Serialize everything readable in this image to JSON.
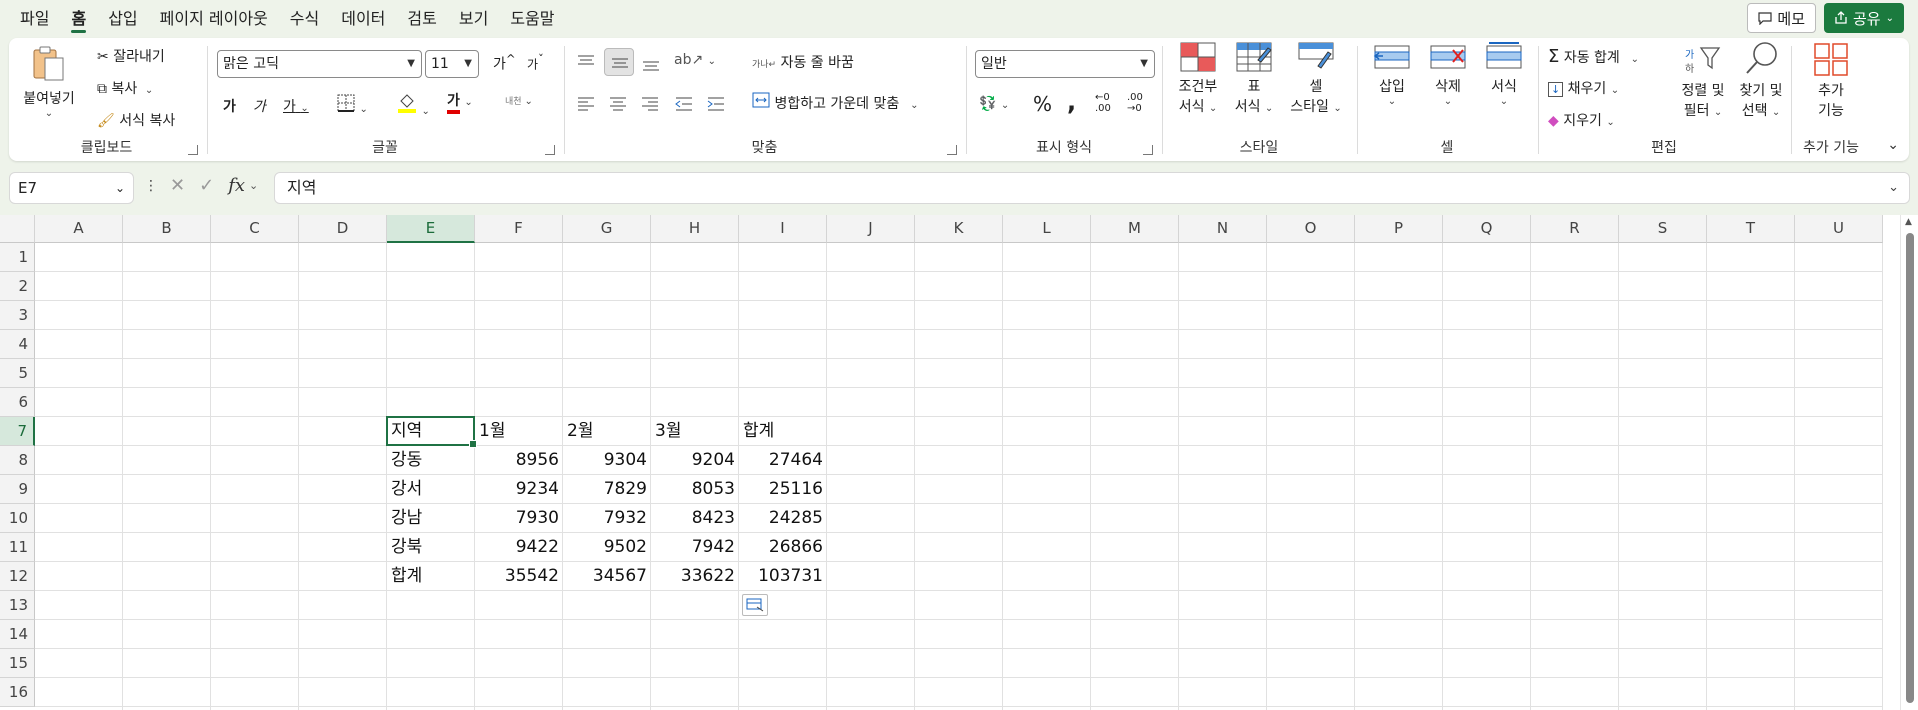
{
  "menu": [
    "파일",
    "홈",
    "삽입",
    "페이지 레이아웃",
    "수식",
    "데이터",
    "검토",
    "보기",
    "도움말"
  ],
  "top_right": {
    "memo": "메모",
    "share": "공유"
  },
  "clipboard": {
    "paste": "붙여넣기",
    "cut": "잘라내기",
    "copy": "복사",
    "format_painter": "서식 복사",
    "label": "클립보드"
  },
  "font": {
    "name": "맑은 고딕",
    "size": "11",
    "grow": "가",
    "shrink": "가",
    "bold": "가",
    "italic": "가",
    "underline": "가",
    "font_color_glyph": "가",
    "phonetic": "내천",
    "label": "글꼴"
  },
  "alignment": {
    "wrap": "자동 줄 바꿈",
    "merge": "병합하고 가운데 맞춤",
    "label": "맞춤"
  },
  "number": {
    "format": "일반",
    "percent": "%",
    "comma": ",",
    "inc": "←0 .00",
    "dec": ".00 →0",
    "label": "표시 형식"
  },
  "styles": {
    "conditional_1": "조건부",
    "conditional_2": "서식",
    "table_1": "표",
    "table_2": "서식",
    "cell_1": "셀",
    "cell_2": "스타일",
    "label": "스타일"
  },
  "cells": {
    "insert": "삽입",
    "delete": "삭제",
    "format": "서식",
    "label": "셀"
  },
  "editing": {
    "autosum": "자동 합계",
    "fill": "채우기",
    "clear": "지우기",
    "sort_1": "정렬 및",
    "sort_2": "필터",
    "find_1": "찾기 및",
    "find_2": "선택",
    "label": "편집"
  },
  "addins": {
    "line1": "추가",
    "line2": "기능",
    "label": "추가 기능"
  },
  "formula_bar": {
    "name_box": "E7",
    "fx": "fx",
    "content": "지역"
  },
  "columns": [
    "A",
    "B",
    "C",
    "D",
    "E",
    "F",
    "G",
    "H",
    "I",
    "J",
    "K",
    "L",
    "M",
    "N",
    "O",
    "P",
    "Q",
    "R",
    "S",
    "T",
    "U"
  ],
  "rows": [
    "1",
    "2",
    "3",
    "4",
    "5",
    "6",
    "7",
    "8",
    "9",
    "10",
    "11",
    "12",
    "13",
    "14",
    "15",
    "16"
  ],
  "table": {
    "header": [
      "지역",
      "1월",
      "2월",
      "3월",
      "합계"
    ],
    "rows": [
      [
        "강동",
        "8956",
        "9304",
        "9204",
        "27464"
      ],
      [
        "강서",
        "9234",
        "7829",
        "8053",
        "25116"
      ],
      [
        "강남",
        "7930",
        "7932",
        "8423",
        "24285"
      ],
      [
        "강북",
        "9422",
        "9502",
        "7942",
        "26866"
      ],
      [
        "합계",
        "35542",
        "34567",
        "33622",
        "103731"
      ]
    ]
  },
  "colors": {
    "accent": "#1f7244",
    "share_bg": "#1b7a3e"
  }
}
